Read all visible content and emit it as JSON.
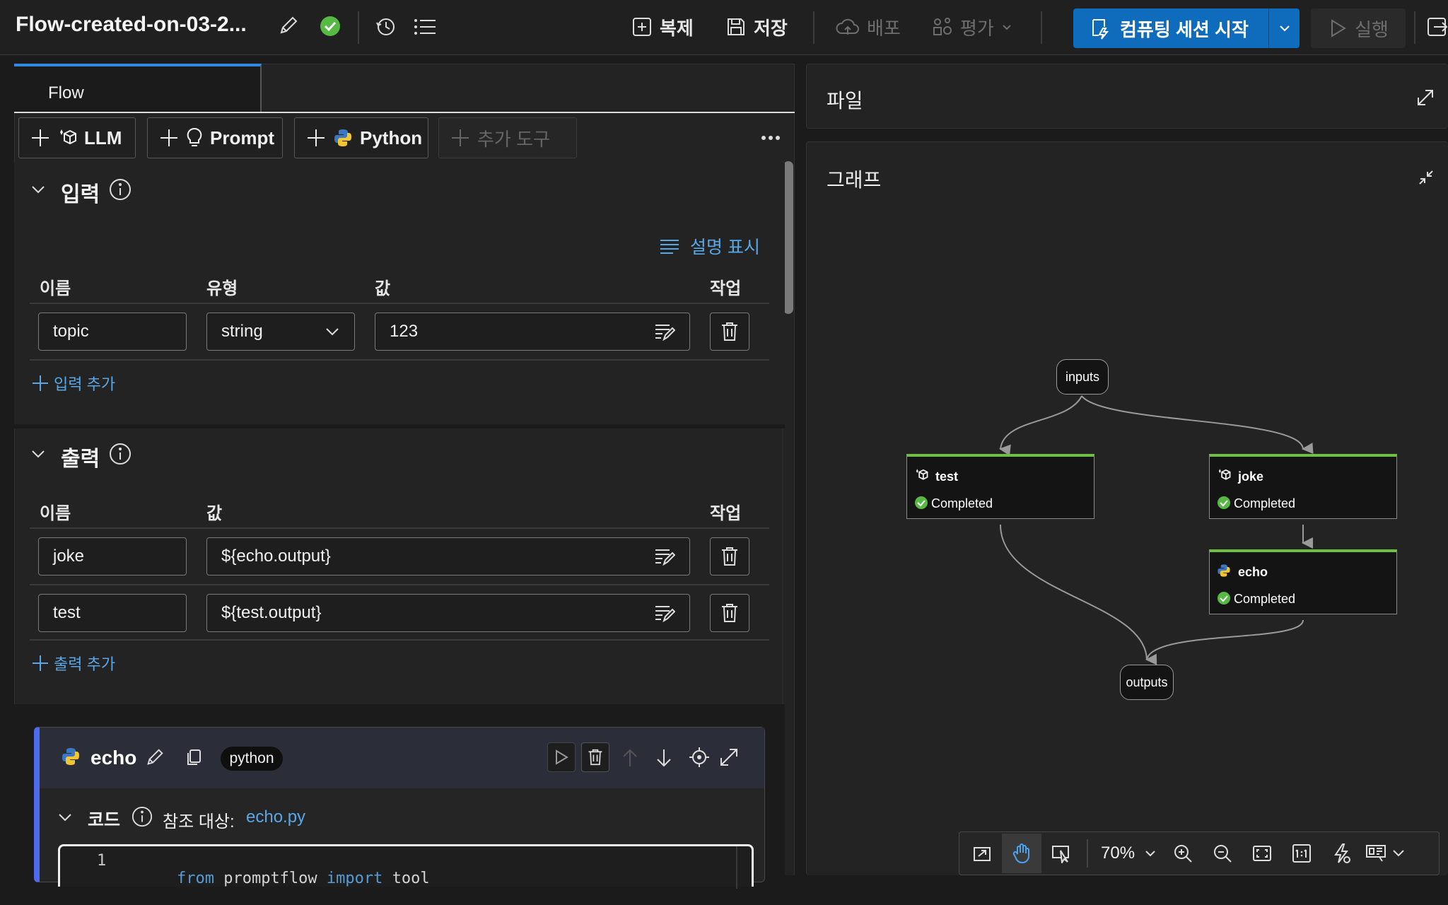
{
  "toolbar": {
    "flow_title": "Flow-created-on-03-2...",
    "clone_label": "복제",
    "save_label": "저장",
    "deploy_label": "배포",
    "evaluate_label": "평가",
    "start_session_label": "컴퓨팅 세션 시작",
    "run_label": "실행"
  },
  "flow_tab": {
    "label": "Flow"
  },
  "tools": {
    "llm": "LLM",
    "prompt": "Prompt",
    "python": "Python",
    "more_tools": "추가 도구"
  },
  "inputs_section": {
    "title": "입력",
    "show_description": "설명 표시",
    "headers": {
      "name": "이름",
      "type": "유형",
      "value": "값",
      "action": "작업"
    },
    "rows": [
      {
        "name": "topic",
        "type": "string",
        "value": "123"
      }
    ],
    "add_label": "입력 추가"
  },
  "outputs_section": {
    "title": "출력",
    "headers": {
      "name": "이름",
      "value": "값",
      "action": "작업"
    },
    "rows": [
      {
        "name": "joke",
        "value": "${echo.output}"
      },
      {
        "name": "test",
        "value": "${test.output}"
      }
    ],
    "add_label": "출력 추가"
  },
  "node_card": {
    "name": "echo",
    "badge": "python",
    "code_label": "코드",
    "ref_label": "참조 대상:",
    "ref_file": "echo.py",
    "code_line_number": "1",
    "code": {
      "kw1": "from",
      "mod": " promptflow ",
      "kw2": "import",
      "name": " tool"
    }
  },
  "files_panel": {
    "title": "파일"
  },
  "graph_panel": {
    "title": "그래프",
    "inputs_label": "inputs",
    "outputs_label": "outputs",
    "nodes": [
      {
        "name": "test",
        "status": "Completed"
      },
      {
        "name": "joke",
        "status": "Completed"
      },
      {
        "name": "echo",
        "status": "Completed"
      }
    ],
    "zoom": "70%"
  },
  "colors": {
    "accent": "#0f6cbd",
    "success": "#57b944",
    "link": "#5aa7e8",
    "node_top": "#6fbf44"
  }
}
